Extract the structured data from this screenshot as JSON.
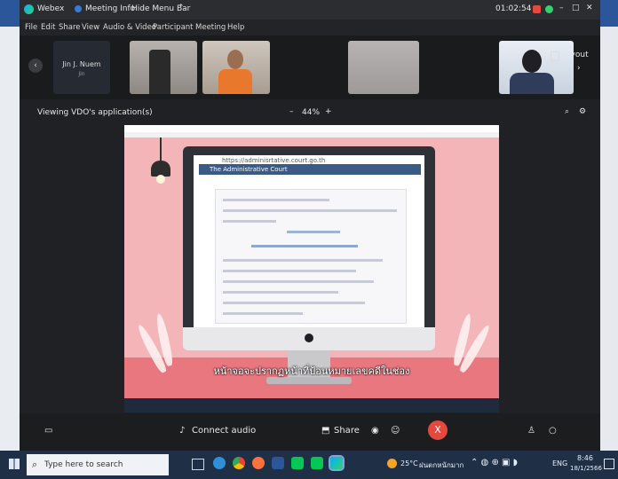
{
  "window": {
    "app_name": "Webex",
    "meeting_info": "Meeting Info",
    "hide_menu_bar": "Hide Menu Bar",
    "clock": "01:02:54"
  },
  "menu": [
    "File",
    "Edit",
    "Share",
    "View",
    "Audio & Video",
    "Participant",
    "Meeting",
    "Help"
  ],
  "participants": {
    "name_tile": "Jin J. Nuem",
    "name_sub": "Jin",
    "layout_label": "Layout"
  },
  "viewbar": {
    "viewing_text": "Viewing VDO's application(s)",
    "zoom": "44%"
  },
  "shared_screen": {
    "url_text": "https://adminisrtative.court.go.th",
    "site_header": "The Administrative Court",
    "subtitle": "หน้าจอจะปรากฏหน้าที่ป้อนหมายเลขคดีในช่อง"
  },
  "controls": {
    "connect_audio": "Connect audio",
    "share": "Share",
    "end_icon": "X"
  },
  "taskbar": {
    "search_placeholder": "Type here to search",
    "weather": "25°C",
    "weather_desc": "ฝนตกหนักมาก",
    "lang": "ENG",
    "time": "8:46",
    "date": "18/1/2566"
  },
  "colors": {
    "webex_bg": "#202124",
    "end_button": "#e5483d",
    "shared_pink": "#f3b5b7",
    "taskbar": "#1f2f46"
  }
}
